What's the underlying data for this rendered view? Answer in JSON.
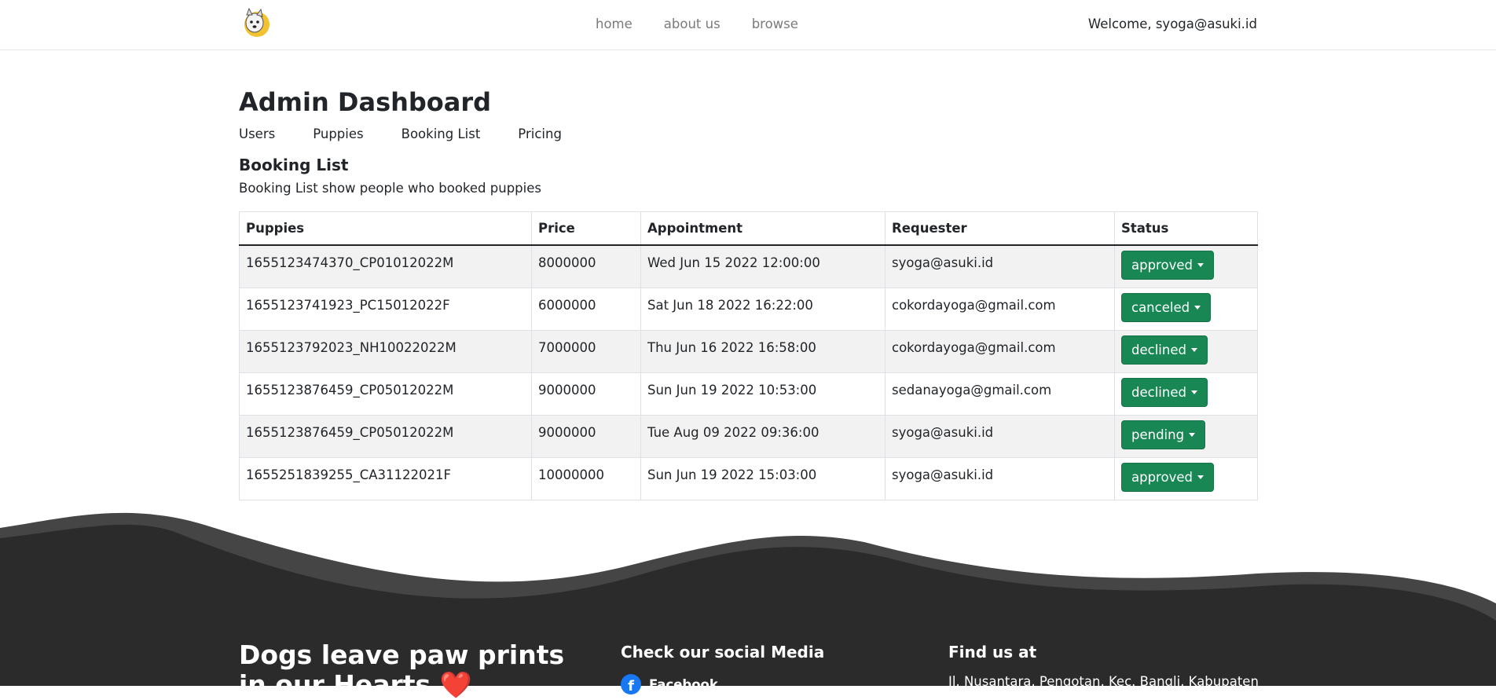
{
  "navbar": {
    "logo_icon": "dog-logo-icon",
    "links": [
      "home",
      "about us",
      "browse"
    ],
    "welcome": "Welcome, syoga@asuki.id"
  },
  "page": {
    "title": "Admin Dashboard",
    "tabs": [
      "Users",
      "Puppies",
      "Booking List",
      "Pricing"
    ],
    "section_title": "Booking List",
    "section_desc": "Booking List show people who booked puppies"
  },
  "table": {
    "headers": [
      "Puppies",
      "Price",
      "Appointment",
      "Requester",
      "Status"
    ],
    "rows": [
      {
        "puppy": "1655123474370_CP01012022M",
        "price": "8000000",
        "appointment": "Wed Jun 15 2022 12:00:00",
        "requester": "syoga@asuki.id",
        "status": "approved"
      },
      {
        "puppy": "1655123741923_PC15012022F",
        "price": "6000000",
        "appointment": "Sat Jun 18 2022 16:22:00",
        "requester": "cokordayoga@gmail.com",
        "status": "canceled"
      },
      {
        "puppy": "1655123792023_NH10022022M",
        "price": "7000000",
        "appointment": "Thu Jun 16 2022 16:58:00",
        "requester": "cokordayoga@gmail.com",
        "status": "declined"
      },
      {
        "puppy": "1655123876459_CP05012022M",
        "price": "9000000",
        "appointment": "Sun Jun 19 2022 10:53:00",
        "requester": "sedanayoga@gmail.com",
        "status": "declined"
      },
      {
        "puppy": "1655123876459_CP05012022M",
        "price": "9000000",
        "appointment": "Tue Aug 09 2022 09:36:00",
        "requester": "syoga@asuki.id",
        "status": "pending"
      },
      {
        "puppy": "1655251839255_CA31122021F",
        "price": "10000000",
        "appointment": "Sun Jun 19 2022 15:03:00",
        "requester": "syoga@asuki.id",
        "status": "approved"
      }
    ]
  },
  "footer": {
    "quote": "Dogs leave paw prints in our Hearts ❤️",
    "social_title": "Check our social Media",
    "facebook_label": "Facebook",
    "find_title": "Find us at",
    "address": "Jl. Nusantara, Pengotan, Kec. Bangli, Kabupaten"
  },
  "colors": {
    "status_button": "#198754",
    "footer_dark": "#2b2b2b",
    "footer_wave": "#444444"
  }
}
